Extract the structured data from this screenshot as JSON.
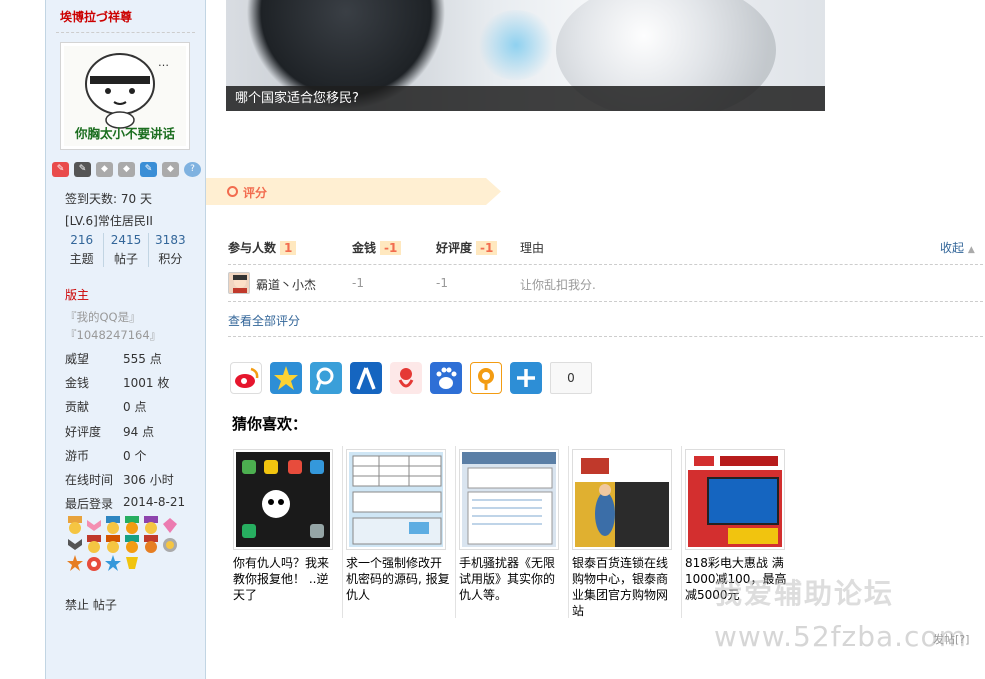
{
  "sidebar": {
    "username": "埃博拉づ祥尊",
    "avatar_caption": "你胸太小不要讲话",
    "signin_days": "签到天数: 70 天",
    "level": "[LV.6]常住居民II",
    "stats": [
      {
        "value": "216",
        "label": "主题"
      },
      {
        "value": "2415",
        "label": "帖子"
      },
      {
        "value": "3183",
        "label": "积分"
      }
    ],
    "group": "版主",
    "qq_line1": "『我的QQ是』",
    "qq_line2": "『1048247164』",
    "fields": [
      {
        "key": "威望",
        "value": "555 点"
      },
      {
        "key": "金钱",
        "value": "1001 枚"
      },
      {
        "key": "贡献",
        "value": "0 点"
      },
      {
        "key": "好评度",
        "value": "94 点"
      },
      {
        "key": "游币",
        "value": "0 个"
      },
      {
        "key": "在线时间",
        "value": "306 小时"
      },
      {
        "key": "最后登录",
        "value": "2014-8-21"
      }
    ],
    "ban_label": "禁止 帖子",
    "medal_icons": [
      "tag-red-icon",
      "tag-dark-icon",
      "diamond-icon",
      "diamond-icon",
      "tag-blue-icon",
      "diamond-icon",
      "question-icon"
    ]
  },
  "banner": {
    "caption": "哪个国家适合您移民?"
  },
  "rating": {
    "tab_title": "评分",
    "header": {
      "participants_label": "参与人数",
      "participants_value": "1",
      "money_label": "金钱",
      "money_value": "-1",
      "rep_label": "好评度",
      "rep_value": "-1",
      "reason_label": "理由",
      "collapse": "收起"
    },
    "row": {
      "user": "霸道丶小杰",
      "money": "-1",
      "rep": "-1",
      "reason": "让你乱扣我分."
    },
    "view_all": "查看全部评分"
  },
  "share": {
    "icons": [
      "weibo-icon",
      "qzone-icon",
      "tencent-weibo-icon",
      "renren-icon",
      "kaixin-icon",
      "baidu-icon",
      "pengyou-icon",
      "plus-icon"
    ],
    "count": "0"
  },
  "guess": {
    "title": "猜你喜欢：",
    "cards": [
      {
        "text": "你有仇人吗？我来教你报复他！ ..逆天了"
      },
      {
        "text": "求一个强制修改开机密码的源码, 报复仇人"
      },
      {
        "text": "手机骚扰器《无限试用版》其实你的仇人等。"
      },
      {
        "text": "银泰百货连锁在线购物中心，银泰商业集团官方购物网站"
      },
      {
        "text": "818彩电大惠战 满1000减100，最高减5000元"
      }
    ]
  },
  "watermark": {
    "line1": "我爱辅助论坛",
    "line2": "www.52fzba.com"
  },
  "report": "发帖[?]"
}
